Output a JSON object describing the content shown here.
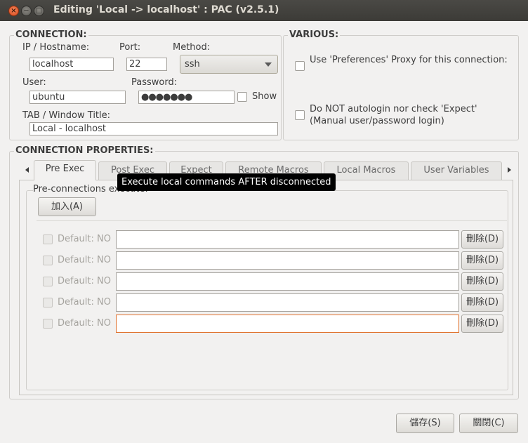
{
  "window": {
    "title": "Editing 'Local -> localhost' : PAC (v2.5.1)",
    "close_glyph": "×",
    "minimize_glyph": "−",
    "maximize_glyph": "□"
  },
  "connection": {
    "section_label": "CONNECTION:",
    "host_label": "IP / Hostname:",
    "host_value": "localhost",
    "port_label": "Port:",
    "port_value": "22",
    "method_label": "Method:",
    "method_value": "ssh",
    "user_label": "User:",
    "user_value": "ubuntu",
    "password_label": "Password:",
    "password_mask": "●●●●●●●",
    "show_label": "Show",
    "tab_title_label": "TAB / Window Title:",
    "tab_title_value": "Local - localhost"
  },
  "various": {
    "section_label": "VARIOUS:",
    "use_proxy_label": "Use 'Preferences' Proxy for this connection:",
    "no_autologin_line1": "Do NOT autologin nor check 'Expect'",
    "no_autologin_line2": "(Manual user/password login)"
  },
  "properties": {
    "section_label": "CONNECTION PROPERTIES:",
    "tabs": [
      "Pre Exec",
      "Post Exec",
      "Expect",
      "Remote Macros",
      "Local Macros",
      "User Variables"
    ],
    "active_tab": "Pre Exec",
    "tooltip": "Execute local commands AFTER disconnected",
    "pre_conn_label": "Pre-connections execute:",
    "add_button": "加入(A)",
    "rows": [
      {
        "default_label": "Default: NO",
        "command": "",
        "delete_label": "刪除(D)"
      },
      {
        "default_label": "Default: NO",
        "command": "",
        "delete_label": "刪除(D)"
      },
      {
        "default_label": "Default: NO",
        "command": "",
        "delete_label": "刪除(D)"
      },
      {
        "default_label": "Default: NO",
        "command": "",
        "delete_label": "刪除(D)"
      },
      {
        "default_label": "Default: NO",
        "command": "",
        "delete_label": "刪除(D)"
      }
    ]
  },
  "footer": {
    "save_button": "儲存(S)",
    "close_button": "關閉(C)"
  },
  "colors": {
    "titlebar": "#3c3b37",
    "close_button": "#e95420",
    "focus_border": "#e0722e",
    "tooltip_bg": "#000000"
  }
}
